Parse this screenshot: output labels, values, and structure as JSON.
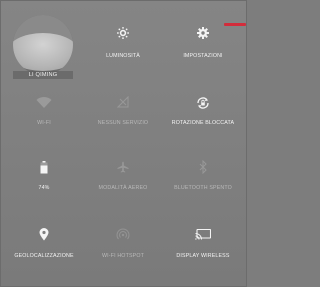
{
  "user": {
    "name": "LI QIMING"
  },
  "tiles": [
    {
      "label": "LUMINOSITÀ",
      "icon": "brightness-icon",
      "active": true
    },
    {
      "label": "IMPOSTAZIONI",
      "icon": "settings-gear-icon",
      "active": true
    },
    {
      "label": "WI-FI",
      "icon": "wifi-icon",
      "active": false
    },
    {
      "label": "NESSUN SERVIZIO",
      "icon": "no-signal-icon",
      "active": false
    },
    {
      "label": "ROTAZIONE BLOCCATA",
      "icon": "rotation-lock-icon",
      "active": true
    },
    {
      "label": "74%",
      "icon": "battery-icon",
      "active": true
    },
    {
      "label": "MODALITÀ AEREO",
      "icon": "airplane-icon",
      "active": false
    },
    {
      "label": "BLUETOOTH SPENTO",
      "icon": "bluetooth-icon",
      "active": false
    },
    {
      "label": "GEOLOCALIZZAZIONE",
      "icon": "location-pin-icon",
      "active": true
    },
    {
      "label": "WI-FI HOTSPOT",
      "icon": "hotspot-icon",
      "active": false
    },
    {
      "label": "DISPLAY WIRELESS",
      "icon": "cast-screen-icon",
      "active": true
    }
  ],
  "colors": {
    "accent_red": "#d32d3b",
    "active": "#f4f4f4",
    "inactive": "#b9b9b9"
  }
}
